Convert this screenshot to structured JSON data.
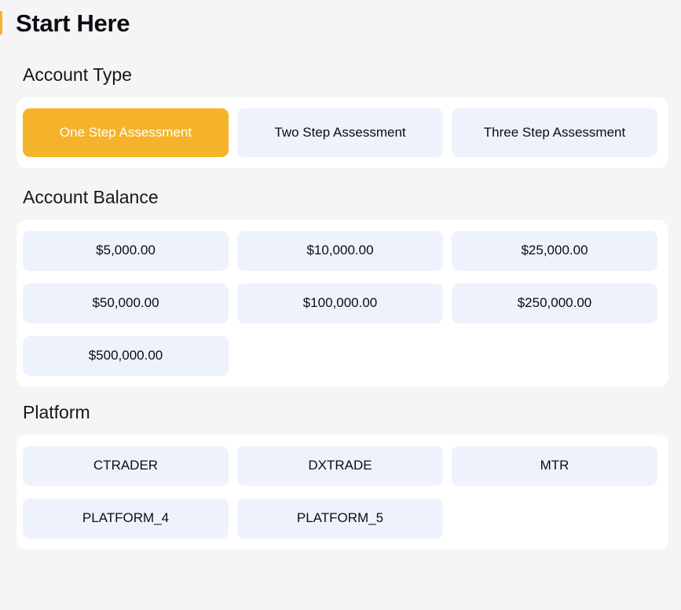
{
  "colors": {
    "accent": "#f5b32b",
    "option_bg": "#eef2fd",
    "card_bg": "#ffffff",
    "page_bg": "#f5f5f6",
    "text": "#0b0d12",
    "selected_text": "#ffffff"
  },
  "header": {
    "title": "Start Here"
  },
  "sections": {
    "account_type": {
      "heading": "Account Type",
      "options": [
        {
          "label": "One Step Assessment",
          "selected": true
        },
        {
          "label": "Two Step Assessment",
          "selected": false
        },
        {
          "label": "Three Step Assessment",
          "selected": false
        }
      ]
    },
    "account_balance": {
      "heading": "Account Balance",
      "options": [
        {
          "label": "$5,000.00",
          "selected": false
        },
        {
          "label": "$10,000.00",
          "selected": false
        },
        {
          "label": "$25,000.00",
          "selected": false
        },
        {
          "label": "$50,000.00",
          "selected": false
        },
        {
          "label": "$100,000.00",
          "selected": false
        },
        {
          "label": "$250,000.00",
          "selected": false
        },
        {
          "label": "$500,000.00",
          "selected": false
        }
      ]
    },
    "platform": {
      "heading": "Platform",
      "options": [
        {
          "label": "CTRADER",
          "selected": false
        },
        {
          "label": "DXTRADE",
          "selected": false
        },
        {
          "label": "MTR",
          "selected": false
        },
        {
          "label": "PLATFORM_4",
          "selected": false
        },
        {
          "label": "PLATFORM_5",
          "selected": false
        }
      ]
    }
  }
}
